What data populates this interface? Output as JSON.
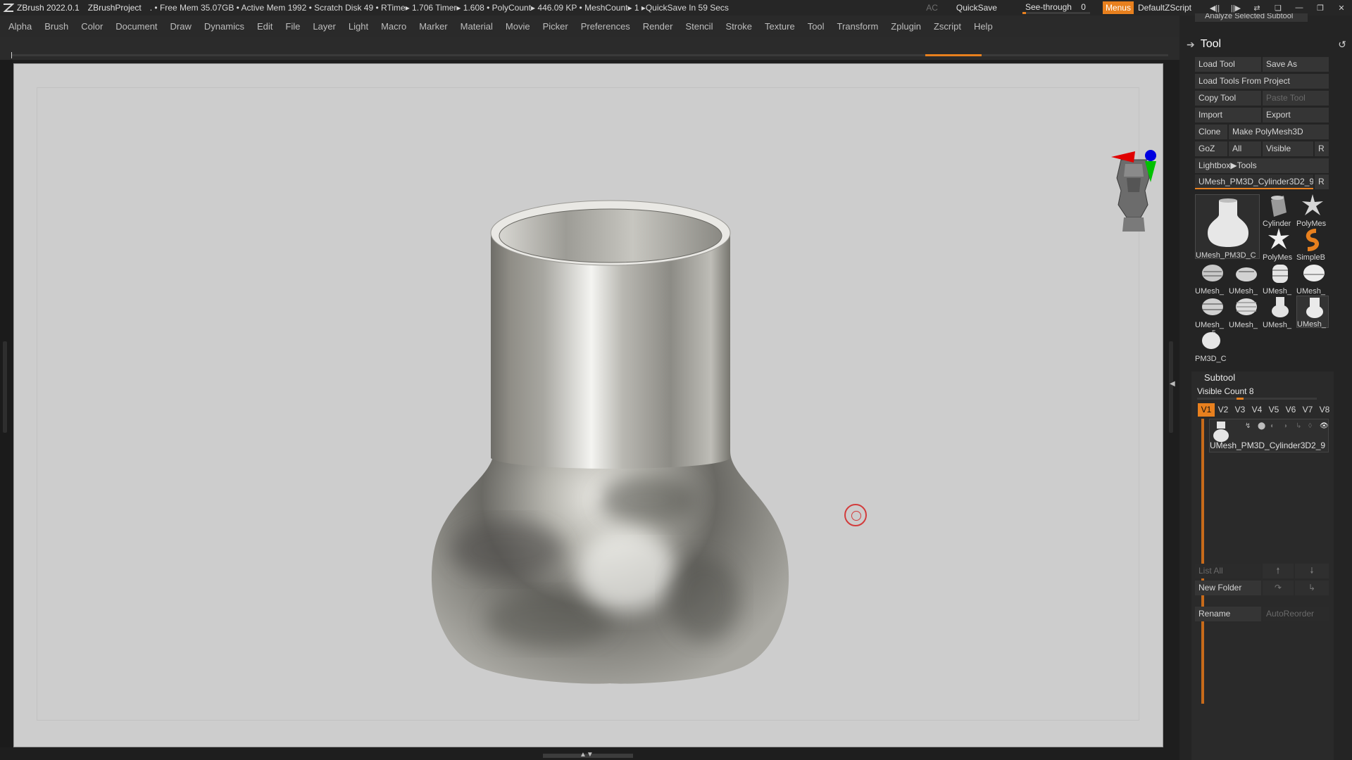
{
  "titlebar": {
    "app": "ZBrush 2022.0.1",
    "project": "ZBrushProject",
    "stats": ". • Free Mem 35.07GB • Active Mem 1992 • Scratch Disk 49 •   RTime▸ 1.706 Timer▸ 1.608 • PolyCount▸ 446.09 KP  • MeshCount▸ 1  ▸QuickSave In 59 Secs",
    "ac": "AC",
    "quicksave": "QuickSave",
    "seethrough_label": "See-through",
    "seethrough_value": "0",
    "seethrough_fraction": 0.05,
    "menus": "Menus",
    "default_zscript": "DefaultZScript"
  },
  "menubar": [
    "Alpha",
    "Brush",
    "Color",
    "Document",
    "Draw",
    "Dynamics",
    "Edit",
    "File",
    "Layer",
    "Light",
    "Macro",
    "Marker",
    "Material",
    "Movie",
    "Picker",
    "Preferences",
    "Render",
    "Stencil",
    "Stroke",
    "Texture",
    "Tool",
    "Transform",
    "Zplugin",
    "Zscript",
    "Help"
  ],
  "panel": {
    "cut_label": "Analyze Selected Subtool",
    "title": "Tool",
    "load_tool": "Load Tool",
    "save_as": "Save As",
    "load_from_project": "Load Tools From Project",
    "copy_tool": "Copy Tool",
    "paste_tool": "Paste Tool",
    "import": "Import",
    "export": "Export",
    "clone": "Clone",
    "make_polymesh": "Make PolyMesh3D",
    "goz": "GoZ",
    "all": "All",
    "visible": "Visible",
    "r": "R",
    "lightbox_tools": "Lightbox▶Tools",
    "current_tool": "UMesh_PM3D_Cylinder3D2_9",
    "current_r": "R",
    "thumbs": {
      "main": "UMesh_PM3D_C",
      "cylinder": "Cylinder",
      "polymesh1": "PolyMes",
      "polymesh2": "PolyMes",
      "simpleb": "SimpleB",
      "umesh": "UMesh_",
      "pm3d_count": "5",
      "pm3d": "PM3D_C"
    }
  },
  "subtool": {
    "title": "Subtool",
    "visible_count": "Visible Count 8",
    "visible_fraction": 0.33,
    "vtabs": [
      "V1",
      "V2",
      "V3",
      "V4",
      "V5",
      "V6",
      "V7",
      "V8"
    ],
    "active_vtab": "V1",
    "item_name": "UMesh_PM3D_Cylinder3D2_9",
    "list_all": "List All",
    "new_folder": "New Folder",
    "rename": "Rename",
    "auto_reorder": "AutoReorder"
  },
  "colors": {
    "accent": "#e8801e",
    "canvas_bg": "#cdcdcd",
    "panel_bg": "#242424"
  }
}
